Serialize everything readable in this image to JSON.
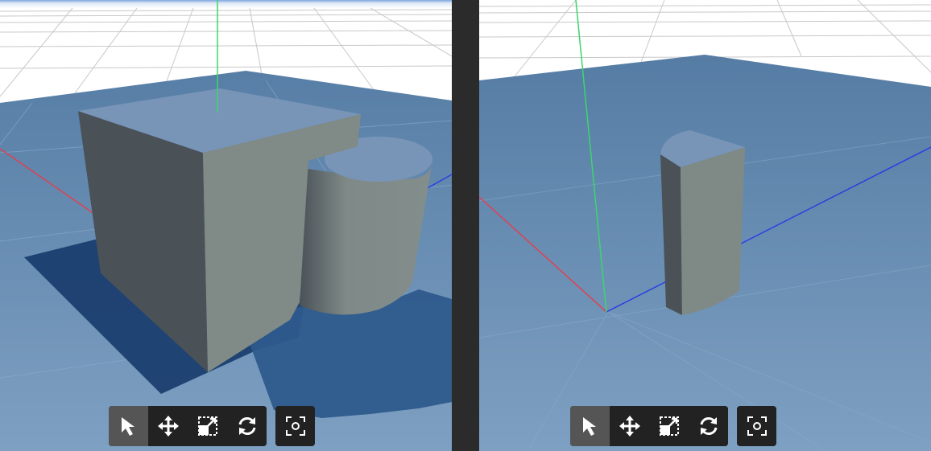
{
  "viewports": [
    {
      "id": "left",
      "toolbar": {
        "active_tool": "select",
        "tools": [
          {
            "name": "select",
            "icon": "pointer-arrow-icon"
          },
          {
            "name": "move",
            "icon": "move-arrows-icon"
          },
          {
            "name": "scale",
            "icon": "scale-icon"
          },
          {
            "name": "rotate",
            "icon": "rotate-icon"
          }
        ],
        "camera_icon": "focus-camera-icon"
      }
    },
    {
      "id": "right",
      "toolbar": {
        "active_tool": "select",
        "tools": [
          {
            "name": "select",
            "icon": "pointer-arrow-icon"
          },
          {
            "name": "move",
            "icon": "move-arrows-icon"
          },
          {
            "name": "scale",
            "icon": "scale-icon"
          },
          {
            "name": "rotate",
            "icon": "rotate-icon"
          }
        ],
        "camera_icon": "focus-camera-icon"
      }
    }
  ],
  "colors": {
    "sky": "#ffffff",
    "ground": "#6a8fb3",
    "x_axis": "#e04050",
    "y_axis": "#3cd66c",
    "z_axis": "#2a3fe0",
    "object_light": "#7f8c8c",
    "object_dark": "#4a5258",
    "object_top": "#7895b8",
    "shadow": "#163a6a",
    "toolbar_bg": "#222222",
    "toolbar_active": "#555555"
  }
}
